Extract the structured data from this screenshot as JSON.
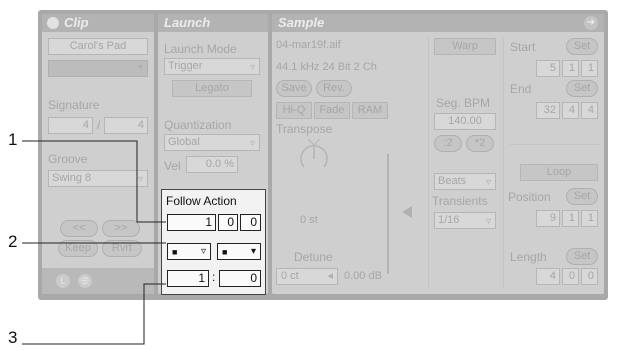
{
  "clip": {
    "title": "Clip",
    "name": "Carol's Pad",
    "signature_label": "Signature",
    "sig_num": "4",
    "sig_sep": "/",
    "sig_den": "4",
    "groove_label": "Groove",
    "groove_value": "Swing 8",
    "nav_prev": "<<",
    "nav_next": ">>",
    "keep": "Keep",
    "rvrt": "Rvrt",
    "icon_l": "L",
    "icon_globe": "⊕"
  },
  "launch": {
    "title": "Launch",
    "mode_label": "Launch Mode",
    "mode_value": "Trigger",
    "legato": "Legato",
    "quant_label": "Quantization",
    "quant_value": "Global",
    "vel_label": "Vel",
    "vel_value": "0.0 %"
  },
  "follow_action": {
    "title": "Follow Action",
    "time": [
      "1",
      "0",
      "0"
    ],
    "action_a": "■",
    "action_b": "■",
    "chance_a": "1",
    "chance_sep": ":",
    "chance_b": "0"
  },
  "sample": {
    "title": "Sample",
    "filename": "04-mar19f.aif",
    "format": "44.1 kHz 24 Bit 2 Ch",
    "save": "Save",
    "rev": "Rev.",
    "hiq": "Hi-Q",
    "fade": "Fade",
    "ram": "RAM",
    "transpose_label": "Transpose",
    "transpose_value": "0 st",
    "detune_label": "Detune",
    "detune_value": "0 ct",
    "gain_value": "0.00 dB",
    "warp": "Warp",
    "segbpm_label": "Seg. BPM",
    "segbpm_value": "140.00",
    "half": ":2",
    "double": "*2",
    "warp_mode": "Beats",
    "transients_label": "Transients",
    "transients_value": "1/16",
    "start_label": "Start",
    "set": "Set",
    "start": [
      "5",
      "1",
      "1"
    ],
    "end_label": "End",
    "end": [
      "32",
      "4",
      "4"
    ],
    "loop": "Loop",
    "position_label": "Position",
    "position": [
      "9",
      "1",
      "1"
    ],
    "length_label": "Length",
    "length": [
      "4",
      "0",
      "0"
    ]
  },
  "callouts": [
    "1",
    "2",
    "3"
  ]
}
